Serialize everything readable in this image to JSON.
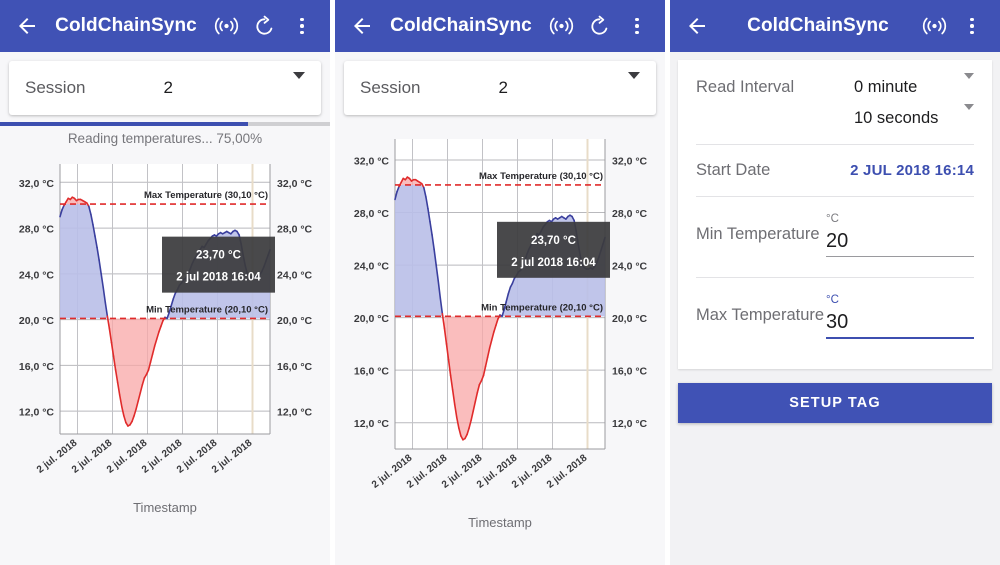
{
  "app": {
    "title": "ColdChainSync",
    "header_color": "#4052b5",
    "icons": {
      "back": "back-arrow-icon",
      "nfc": "nfc-broadcast-icon",
      "refresh": "refresh-icon",
      "overflow": "overflow-menu-icon"
    }
  },
  "panel1": {
    "session": {
      "label": "Session",
      "value": "2"
    },
    "progress": {
      "percent": 75,
      "text": "Reading temperatures... 75,00%"
    }
  },
  "panel2": {
    "session": {
      "label": "Session",
      "value": "2"
    }
  },
  "panel3": {
    "read_interval": {
      "label": "Read Interval",
      "minutes_value": "0 minute",
      "seconds_value": "10 seconds"
    },
    "start_date": {
      "label": "Start Date",
      "value": "2 JUL 2018 16:14"
    },
    "min_temperature": {
      "label": "Min Temperature",
      "unit": "°C",
      "value": "20"
    },
    "max_temperature": {
      "label": "Max Temperature",
      "unit": "°C",
      "value": "30"
    },
    "setup_button": "SETUP TAG"
  },
  "chart_data": {
    "type": "area",
    "title": "",
    "xlabel": "Timestamp",
    "ylabel": "",
    "ylim": [
      10,
      33.6
    ],
    "yticks": [
      12,
      16,
      20,
      24,
      28,
      32
    ],
    "ytick_labels": [
      "12,0 °C",
      "16,0 °C",
      "20,0 °C",
      "24,0 °C",
      "28,0 °C",
      "32,0 °C"
    ],
    "ytick_labels_right": [
      "12,0 °C",
      "16,0 °C",
      "20,0 °C",
      "24,0 °C",
      "28,0 °C",
      "32,0 °C"
    ],
    "xtick_labels": [
      "2 jul. 2018",
      "2 jul. 2018",
      "2 jul. 2018",
      "2 jul. 2018",
      "2 jul. 2018",
      "2 jul. 2018"
    ],
    "grid": true,
    "legend": "none",
    "thresholds": [
      {
        "name": "Max Temperature",
        "label": "Max Temperature (30,10 °C)",
        "value": 30.1,
        "color": "#e02b2b",
        "style": "dashed"
      },
      {
        "name": "Min Temperature",
        "label": "Min Temperature (20,10 °C)",
        "value": 20.1,
        "color": "#e02b2b",
        "style": "dashed"
      }
    ],
    "tooltip": {
      "value": "23,70 °C",
      "timestamp": "2 jul 2018 16:04",
      "bg": "#3b3b3d",
      "fg": "#ffffff"
    },
    "series_color_in_range": "#3a3f9e",
    "series_color_out_range": "#e02b2b",
    "fill_in_range": "#b9bfe8",
    "fill_out_range": "#f8a7a7",
    "values": [
      29.0,
      29.6,
      30.0,
      30.3,
      30.6,
      30.5,
      30.7,
      30.6,
      30.4,
      30.5,
      30.5,
      30.4,
      30.3,
      30.2,
      29.9,
      29.2,
      28.3,
      27.3,
      26.3,
      25.2,
      24.0,
      22.8,
      21.5,
      20.3,
      19.2,
      18.0,
      16.8,
      15.6,
      14.5,
      13.4,
      12.4,
      11.6,
      11.0,
      10.7,
      10.8,
      11.1,
      11.6,
      12.2,
      12.9,
      13.6,
      14.3,
      14.9,
      15.2,
      15.6,
      16.3,
      17.0,
      17.7,
      18.3,
      18.9,
      19.4,
      19.9,
      20.2,
      20.1,
      20.6,
      21.2,
      21.8,
      22.3,
      22.6,
      23.0,
      23.2,
      23.5,
      23.6,
      23.9,
      24.3,
      24.8,
      25.2,
      25.5,
      25.8,
      26.1,
      26.4,
      26.3,
      26.6,
      26.9,
      27.1,
      27.3,
      27.4,
      27.3,
      27.5,
      27.6,
      27.5,
      27.6,
      27.7,
      27.6,
      27.5,
      27.7,
      27.8,
      27.7,
      27.4,
      26.6,
      25.6,
      24.7,
      24.0,
      23.8,
      23.7,
      23.7,
      23.8,
      23.7,
      23.9,
      24.2,
      24.6,
      25.1,
      25.6,
      26.1
    ]
  }
}
